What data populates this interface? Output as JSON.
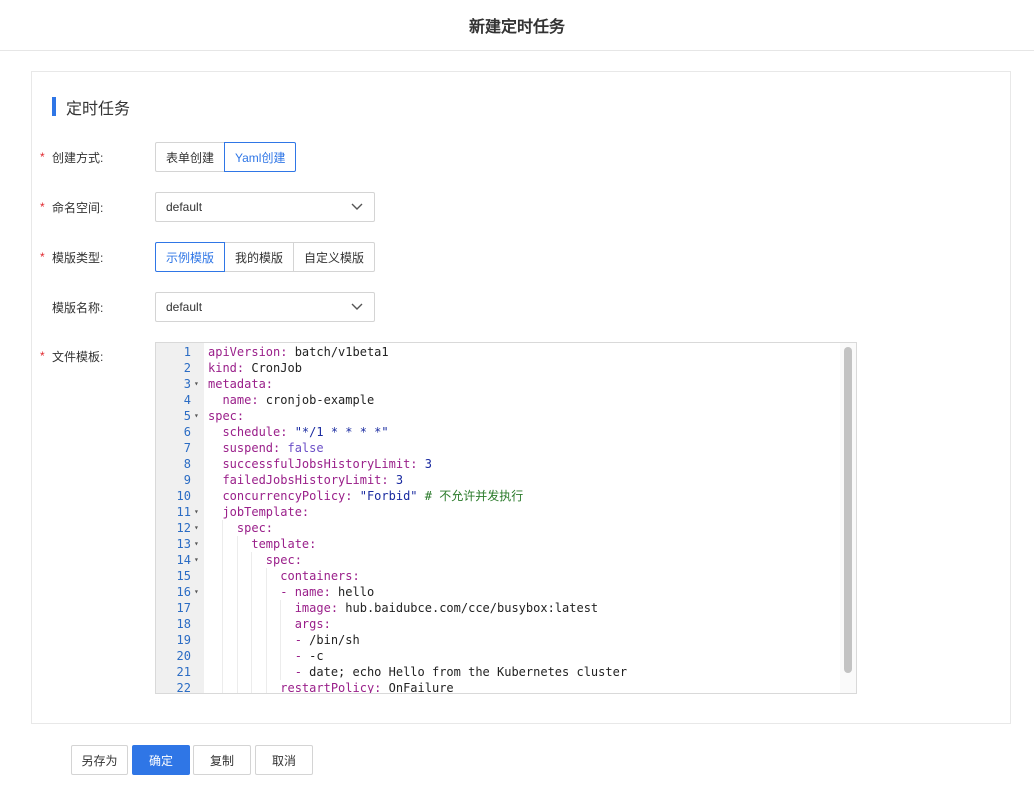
{
  "header": {
    "title": "新建定时任务"
  },
  "section": {
    "title": "定时任务"
  },
  "form": {
    "create_mode": {
      "label": "创建方式:",
      "required": true,
      "options": [
        "表单创建",
        "Yaml创建"
      ],
      "selected": "Yaml创建"
    },
    "namespace": {
      "label": "命名空间:",
      "required": true,
      "value": "default"
    },
    "template_type": {
      "label": "模版类型:",
      "required": true,
      "options": [
        "示例模版",
        "我的模版",
        "自定义模版"
      ],
      "selected": "示例模版"
    },
    "template_name": {
      "label": "模版名称:",
      "required": false,
      "value": "default"
    },
    "file_template": {
      "label": "文件模板:",
      "required": true
    }
  },
  "editor": {
    "lines": [
      {
        "n": "1",
        "fold": false,
        "indent": 0,
        "tokens": [
          [
            "k",
            "apiVersion:"
          ],
          [
            "v",
            " batch/v1beta1"
          ]
        ]
      },
      {
        "n": "2",
        "fold": false,
        "indent": 0,
        "tokens": [
          [
            "k",
            "kind:"
          ],
          [
            "v",
            " CronJob"
          ]
        ]
      },
      {
        "n": "3",
        "fold": true,
        "indent": 0,
        "tokens": [
          [
            "k",
            "metadata:"
          ]
        ]
      },
      {
        "n": "4",
        "fold": false,
        "indent": 1,
        "tokens": [
          [
            "k",
            "name:"
          ],
          [
            "v",
            " cronjob-example"
          ]
        ]
      },
      {
        "n": "5",
        "fold": true,
        "indent": 0,
        "tokens": [
          [
            "k",
            "spec:"
          ]
        ]
      },
      {
        "n": "6",
        "fold": false,
        "indent": 1,
        "tokens": [
          [
            "k",
            "schedule:"
          ],
          [
            "s",
            " \"*/1 * * * *\""
          ]
        ]
      },
      {
        "n": "7",
        "fold": false,
        "indent": 1,
        "tokens": [
          [
            "k",
            "suspend:"
          ],
          [
            "b",
            " false"
          ]
        ]
      },
      {
        "n": "8",
        "fold": false,
        "indent": 1,
        "tokens": [
          [
            "k",
            "successfulJobsHistoryLimit:"
          ],
          [
            "n",
            " 3"
          ]
        ]
      },
      {
        "n": "9",
        "fold": false,
        "indent": 1,
        "tokens": [
          [
            "k",
            "failedJobsHistoryLimit:"
          ],
          [
            "n",
            " 3"
          ]
        ]
      },
      {
        "n": "10",
        "fold": false,
        "indent": 1,
        "tokens": [
          [
            "k",
            "concurrencyPolicy:"
          ],
          [
            "s",
            " \"Forbid\""
          ],
          [
            "c",
            " # 不允许并发执行"
          ]
        ]
      },
      {
        "n": "11",
        "fold": true,
        "indent": 1,
        "tokens": [
          [
            "k",
            "jobTemplate:"
          ]
        ]
      },
      {
        "n": "12",
        "fold": true,
        "indent": 2,
        "tokens": [
          [
            "k",
            "spec:"
          ]
        ]
      },
      {
        "n": "13",
        "fold": true,
        "indent": 3,
        "tokens": [
          [
            "k",
            "template:"
          ]
        ]
      },
      {
        "n": "14",
        "fold": true,
        "indent": 4,
        "tokens": [
          [
            "k",
            "spec:"
          ]
        ]
      },
      {
        "n": "15",
        "fold": false,
        "indent": 5,
        "tokens": [
          [
            "k",
            "containers:"
          ]
        ]
      },
      {
        "n": "16",
        "fold": true,
        "indent": 5,
        "tokens": [
          [
            "p",
            "- "
          ],
          [
            "k",
            "name:"
          ],
          [
            "v",
            " hello"
          ]
        ]
      },
      {
        "n": "17",
        "fold": false,
        "indent": 6,
        "tokens": [
          [
            "k",
            "image:"
          ],
          [
            "v",
            " hub.baidubce.com/cce/busybox:latest"
          ]
        ]
      },
      {
        "n": "18",
        "fold": false,
        "indent": 6,
        "tokens": [
          [
            "k",
            "args:"
          ]
        ]
      },
      {
        "n": "19",
        "fold": false,
        "indent": 6,
        "tokens": [
          [
            "p",
            "- "
          ],
          [
            "v",
            "/bin/sh"
          ]
        ]
      },
      {
        "n": "20",
        "fold": false,
        "indent": 6,
        "tokens": [
          [
            "p",
            "- "
          ],
          [
            "v",
            "-c"
          ]
        ]
      },
      {
        "n": "21",
        "fold": false,
        "indent": 6,
        "tokens": [
          [
            "p",
            "- "
          ],
          [
            "v",
            "date; echo Hello from the Kubernetes cluster"
          ]
        ]
      },
      {
        "n": "22",
        "fold": false,
        "indent": 5,
        "tokens": [
          [
            "k",
            "restartPolicy:"
          ],
          [
            "v",
            " OnFailure"
          ]
        ]
      }
    ]
  },
  "footer": {
    "save_as": "另存为",
    "confirm": "确定",
    "copy": "复制",
    "cancel": "取消"
  },
  "icons": {
    "select_arrow": "chevron-down-icon",
    "fold_arrow": "fold-triangle-icon"
  },
  "colors": {
    "accent": "#2f76e6",
    "required": "#e0282e",
    "yaml_key": "#9a1f8a",
    "yaml_string": "#1a2ba0",
    "yaml_comment": "#2a7a2a"
  }
}
